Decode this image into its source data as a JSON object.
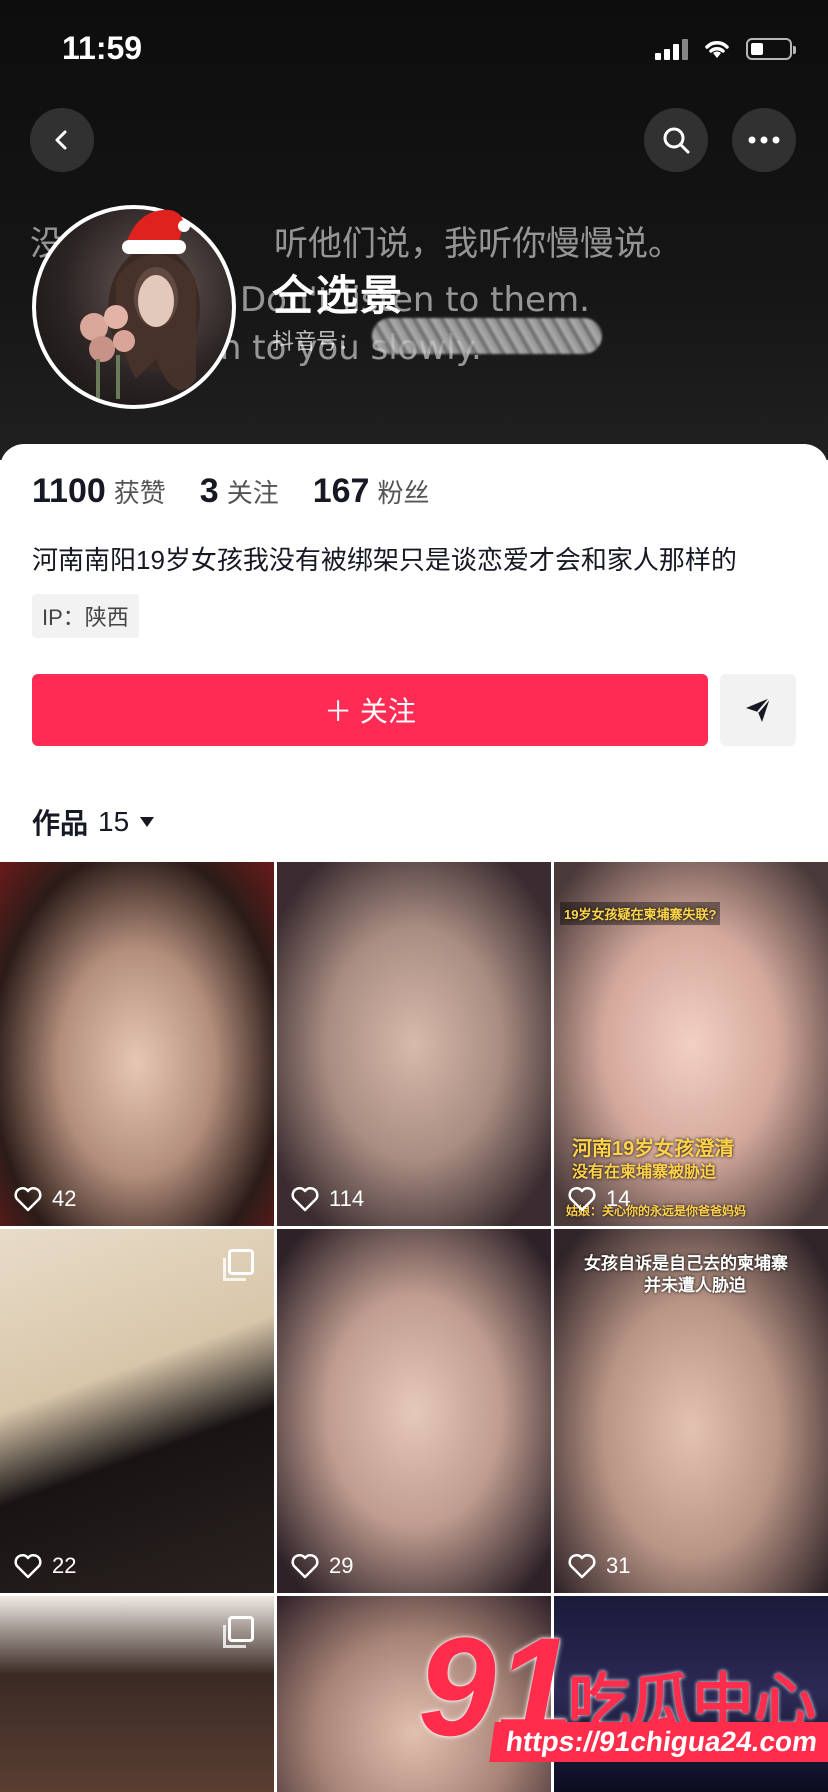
{
  "status_bar": {
    "time": "11:59"
  },
  "header": {
    "background_quote": [
      "没",
      "听他们说，我听你慢慢说。",
      "Don't listen to them.",
      "I'll listen to you slowly."
    ],
    "username": "仝选景",
    "douyin_id_label": "抖音号："
  },
  "stats": [
    {
      "num": "1100",
      "label": "获赞"
    },
    {
      "num": "3",
      "label": "关注"
    },
    {
      "num": "167",
      "label": "粉丝"
    }
  ],
  "bio": "河南南阳19岁女孩我没有被绑架只是谈恋爱才会和家人那样的",
  "ip_tag": "IP：陕西",
  "follow_button": "＋ 关注",
  "works_tab": {
    "label": "作品",
    "count": "15"
  },
  "videos": [
    {
      "likes": "42",
      "overlay": ""
    },
    {
      "likes": "114",
      "overlay": ""
    },
    {
      "likes": "14",
      "overlay": "19岁女孩疑在柬埔寨失联?",
      "caption1": "河南19岁女孩澄清",
      "caption2": "没有在柬埔寨被胁迫",
      "caption3": "姑娘：关心你的永远是你爸爸妈妈"
    },
    {
      "likes": "22",
      "overlay": ""
    },
    {
      "likes": "29",
      "overlay": ""
    },
    {
      "likes": "31",
      "overlay": "女孩自诉是自己去的柬埔寨",
      "overlay2": "并未遭人胁迫"
    },
    {
      "likes": "",
      "overlay": ""
    },
    {
      "likes": "",
      "overlay": ""
    },
    {
      "likes": "",
      "overlay": ""
    }
  ],
  "watermark": {
    "number": "91",
    "text": "吃瓜中心",
    "url": "https://91chigua24.com"
  },
  "colors": {
    "accent": "#fe2c55",
    "watermark": "#ff2d4b"
  }
}
